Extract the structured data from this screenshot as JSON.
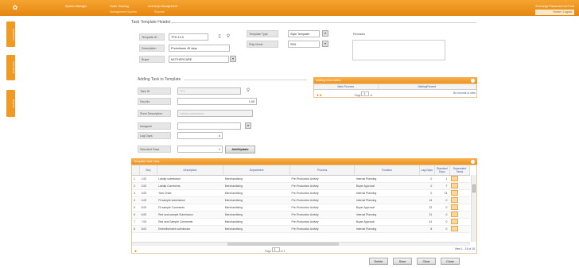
{
  "topbar": {
    "logo": "✿",
    "nav": [
      "System Manager",
      "Order Tracking",
      "Inventory Management"
    ],
    "subnav": [
      "Management System",
      "Reports"
    ],
    "user_line": "Exchange Placement  Ltd Prod",
    "links": "Home | Logout"
  },
  "sidebar": {
    "tabs": [
      "Dashboard",
      "Order Book",
      "Reports"
    ]
  },
  "header": {
    "title": "Task Template Header",
    "template_id_label": "Template ID",
    "template_id_value": "TPH-13-0",
    "description_label": "Description",
    "description_value": "Photoframe 45 days",
    "buyer_label": "Buyer",
    "buyer_value": "MOTHERCARE",
    "template_type_label": "Template Type",
    "template_type_value": "Style Template",
    "ship_mode_label": "Ship Mode",
    "ship_mode_value": "SEA",
    "remarks_label": "Remarks",
    "remarks_value": ""
  },
  "adding": {
    "title": "Adding Task to Template",
    "task_id_label": "Task ID",
    "task_id_value": "TP1",
    "seq_label": "Seq No",
    "seq_value": "1.00",
    "short_desc_label": "Short Description",
    "short_desc_value": "Labdip submission",
    "assignee_label": "Assignee",
    "assignee_value": "",
    "lag_label": "Lag Days",
    "lag_value": "0",
    "std_label": "Standard Days",
    "std_value": "1",
    "add_update": "Add/Update"
  },
  "waiting": {
    "title": "Waiting Information",
    "col1": "Main Process",
    "col2": "WaitingPercent",
    "page_label": "Page",
    "page_value": "1",
    "of_label": "of",
    "no_records": "No records to view"
  },
  "grid": {
    "title": "Template Task View",
    "columns": [
      "Seq",
      "Description",
      "Department",
      "Process",
      "Function",
      "Lag Days",
      "Standard Days",
      "Dependent Tasks"
    ],
    "rows": [
      {
        "n": "1",
        "seq": "1.00",
        "desc": "Labdip submission",
        "dept": "Merchandising",
        "proc": "Pre-Production Activity",
        "func": "Internal Planning",
        "lag": "0",
        "std": "1"
      },
      {
        "n": "2",
        "seq": "2.00",
        "desc": "Labdip Comments",
        "dept": "Merchandising",
        "proc": "Pre-Production Activity",
        "func": "Buyer Approval",
        "lag": "0",
        "std": "7"
      },
      {
        "n": "3",
        "seq": "3.00",
        "desc": "Yarn Order",
        "dept": "Merchandising",
        "proc": "Pre-Production Activity",
        "func": "Internal Planning",
        "lag": "0",
        "std": "14"
      },
      {
        "n": "4",
        "seq": "4.00",
        "desc": "Fit sample submission",
        "dept": "Merchandising",
        "proc": "Pre-Production Activity",
        "func": "Internal Planning",
        "lag": "14",
        "std": "0"
      },
      {
        "n": "5",
        "seq": "5.00",
        "desc": "Fit sample Comments",
        "dept": "Merchandising",
        "proc": "Pre-Production Activity",
        "func": "Buyer Approval",
        "lag": "22",
        "std": "0"
      },
      {
        "n": "6",
        "seq": "6.00",
        "desc": "Red seal sample Submission",
        "dept": "Merchandising",
        "proc": "Pre-Production Activity",
        "func": "Internal Planning",
        "lag": "31",
        "std": "0"
      },
      {
        "n": "7",
        "seq": "7.00",
        "desc": "Red seal Sample Comments",
        "dept": "Merchandising",
        "proc": "Pre-Production Activity",
        "func": "Buyer Approval",
        "lag": "41",
        "std": "0"
      },
      {
        "n": "8",
        "seq": "8.00",
        "desc": "Embellishment submission",
        "dept": "Merchandising",
        "proc": "Pre-Production Activity",
        "func": "Internal Planning",
        "lag": "8",
        "std": "0"
      }
    ],
    "page_label": "Page",
    "page_value": "1",
    "of_label": "of 1",
    "view_info": "View 1 - 18 of 18"
  },
  "actions": [
    "Delete",
    "Save",
    "Clear",
    "Close"
  ],
  "colors": {
    "accent": "#f09a24",
    "panel_head": "#ec9422"
  }
}
